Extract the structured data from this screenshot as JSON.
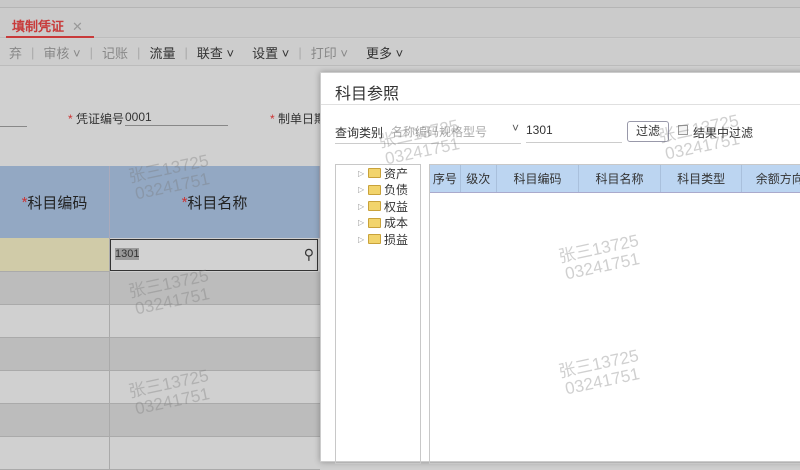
{
  "tab": {
    "label": "填制凭证",
    "close": "✕"
  },
  "toolbar": {
    "items": [
      "弃",
      "审核",
      "记账",
      "流量",
      "联查",
      "设置",
      "打印",
      "更多"
    ],
    "chevron": "⌄"
  },
  "form": {
    "voucher_no_label": "凭证编号",
    "voucher_no": "0001",
    "date_label": "制单日期"
  },
  "grid": {
    "col1": "科目编码",
    "col2": "科目名称",
    "input_value": "1301"
  },
  "dialog": {
    "title": "科目参照",
    "query_label": "查询类别",
    "query_placeholder": "名称编码规格型号",
    "query_value": "1301",
    "filter_button": "过滤",
    "filter_in_results": "结果中过滤",
    "tree": [
      "资产",
      "负债",
      "权益",
      "成本",
      "损益"
    ],
    "columns": [
      "序号",
      "级次",
      "科目编码",
      "科目名称",
      "科目类型",
      "余额方向"
    ]
  },
  "watermark": "张三13725\n03241751"
}
